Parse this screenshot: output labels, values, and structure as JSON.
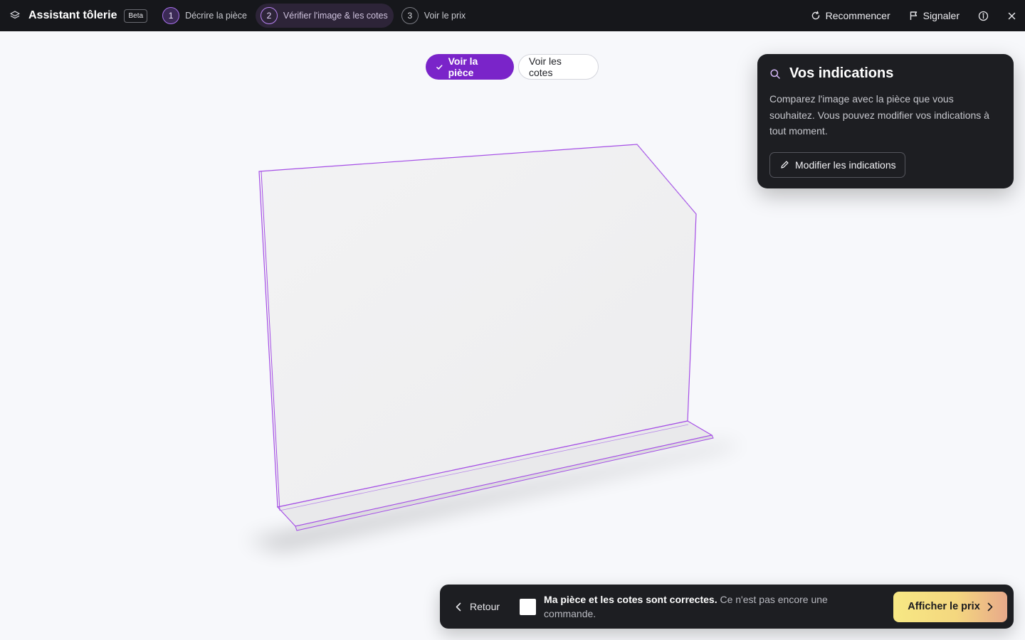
{
  "app": {
    "title": "Assistant tôlerie",
    "badge": "Beta",
    "logo_icon": "layers-icon"
  },
  "steps": [
    {
      "number": "1",
      "label": "Décrire la pièce",
      "state": "done"
    },
    {
      "number": "2",
      "label": "Vérifier l'image & les cotes",
      "state": "active"
    },
    {
      "number": "3",
      "label": "Voir le prix",
      "state": "upcoming"
    }
  ],
  "top_actions": {
    "restart_label": "Recommencer",
    "restart_icon": "refresh-icon",
    "report_label": "Signaler",
    "report_icon": "flag-icon",
    "info_icon": "info-icon",
    "close_icon": "close-icon"
  },
  "view_toggle": {
    "part_label": "Voir la pièce",
    "dims_label": "Voir les cotes",
    "selected": "part"
  },
  "indications": {
    "title": "Vos indications",
    "text": "Comparez l'image avec la pièce que vous souhaitez. Vous pouvez modifier vos indications à tout moment.",
    "edit_label": "Modifier les indications",
    "icon": "search-icon",
    "edit_icon": "pencil-icon"
  },
  "confirm": {
    "back_label": "Retour",
    "checkbox_checked": false,
    "bold_text": "Ma pièce et les cotes sont correctes.",
    "rest_text": "Ce n'est pas encore une commande.",
    "price_label": "Afficher le prix"
  },
  "colors": {
    "topbar": "#16171b",
    "accent": "#7a24c9",
    "edge": "#a54ee6",
    "panel": "#1d1e22",
    "price_gradient_start": "#f7e884",
    "price_gradient_end": "#e8a98a"
  }
}
